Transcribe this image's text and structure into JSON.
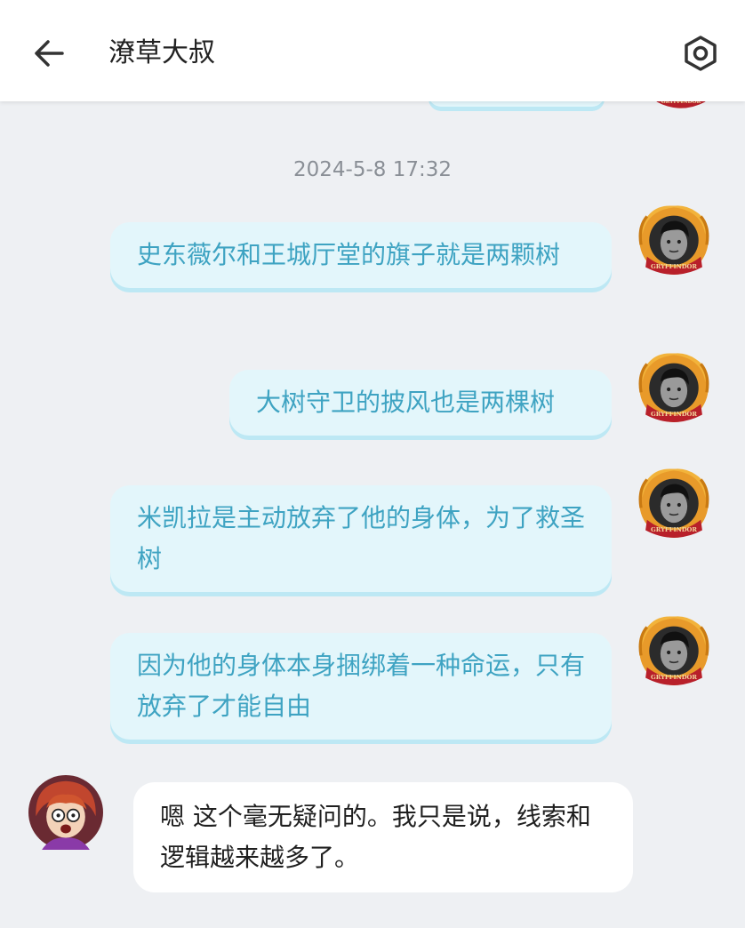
{
  "header": {
    "back_icon": "arrow-left-icon",
    "title": "潦草大叔",
    "settings_icon": "hexagon-gear-icon"
  },
  "chat": {
    "timestamp": "2024-5-8 17:32",
    "outgoing_avatar": {
      "badge_text": "GRYFFINDOR",
      "frame_color": "#d98a1c",
      "ribbon_color": "#b8202a"
    },
    "messages": [
      {
        "side": "right",
        "text": "史东薇尔和王城厅堂的旗子就是两颗树"
      },
      {
        "side": "right",
        "text": "大树守卫的披风也是两棵树"
      },
      {
        "side": "right",
        "text": "米凯拉是主动放弃了他的身体，为了救圣树"
      },
      {
        "side": "right",
        "text": "因为他的身体本身捆绑着一种命运，只有放弃了才能自由"
      },
      {
        "side": "left",
        "text": "嗯 这个毫无疑问的。我只是说，线索和逻辑越来越多了。"
      }
    ]
  },
  "colors": {
    "outgoing_bubble": "#e3f6fb",
    "outgoing_text": "#3ea3c2",
    "incoming_bubble": "#ffffff",
    "background": "#eef0f3"
  }
}
